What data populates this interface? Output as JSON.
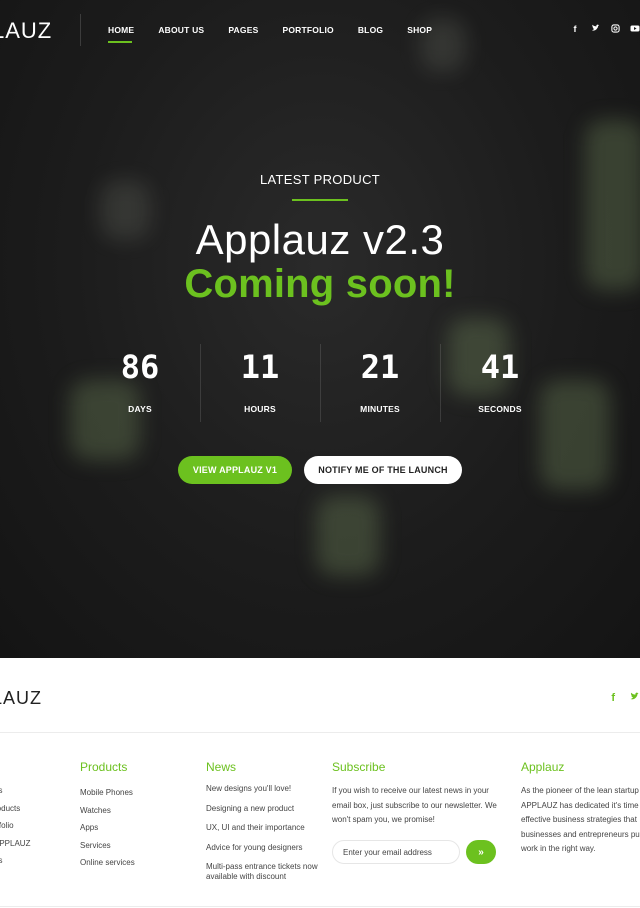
{
  "brand": {
    "logo": "LAUZ",
    "footer_logo": "LAUZ"
  },
  "nav": {
    "items": [
      {
        "label": "HOME",
        "active": true
      },
      {
        "label": "ABOUT US"
      },
      {
        "label": "PAGES"
      },
      {
        "label": "PORTFOLIO"
      },
      {
        "label": "BLOG"
      },
      {
        "label": "SHOP"
      }
    ],
    "social_icons": [
      "facebook-icon",
      "twitter-icon",
      "instagram-icon",
      "youtube-icon"
    ]
  },
  "hero": {
    "eyebrow": "LATEST PRODUCT",
    "title": "Applauz v2.3",
    "subtitle": "Coming soon!",
    "countdown": [
      {
        "value": "86",
        "label": "DAYS"
      },
      {
        "value": "11",
        "label": "HOURS"
      },
      {
        "value": "21",
        "label": "MINUTES"
      },
      {
        "value": "41",
        "label": "SECONDS"
      }
    ],
    "primary_button": "VIEW APPLAUZ V1",
    "secondary_button": "NOTIFY ME OF THE LAUNCH"
  },
  "footer": {
    "social_icons": [
      "facebook-icon",
      "twitter-icon"
    ],
    "col0": {
      "items": [
        "us",
        "roducts",
        "rtfolio",
        "APPLAUZ",
        "us"
      ]
    },
    "products": {
      "heading": "Products",
      "items": [
        "Mobile Phones",
        "Watches",
        "Apps",
        "Services",
        "Online services"
      ]
    },
    "news": {
      "heading": "News",
      "items": [
        "New designs you'll love!",
        "Designing a new product",
        "UX, UI and their importance",
        "Advice for young designers",
        "Multi-pass entrance tickets now available with discount"
      ]
    },
    "subscribe": {
      "heading": "Subscribe",
      "text": "If you wish to receive our latest news in your email box, just subscribe to our newsletter. We won't spam you, we promise!",
      "placeholder": "Enter your email address",
      "submit_icon": "double-arrow-icon"
    },
    "about": {
      "heading": "Applauz",
      "text": "As the pioneer of the lean startup APPLAUZ has dedicated it's time t effective business strategies that businesses and entrepreneurs pu to work in the right way."
    }
  },
  "colors": {
    "accent": "#6cc11f",
    "hero_bg": "#1c1c1c"
  }
}
